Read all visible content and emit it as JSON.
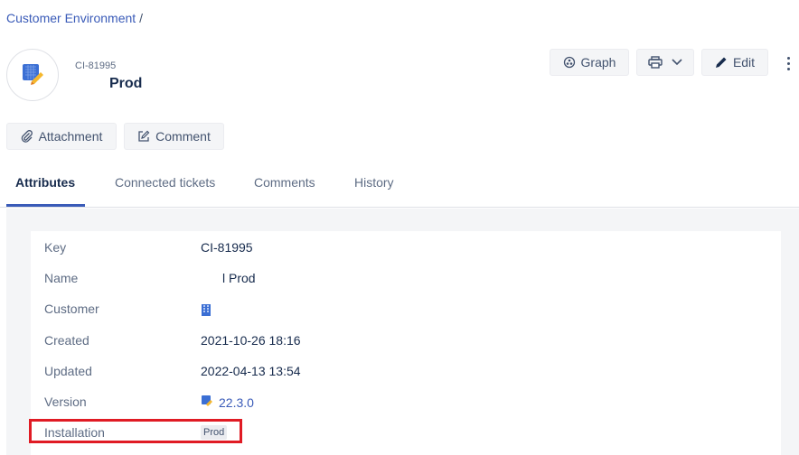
{
  "breadcrumb": {
    "parent": "Customer Environment",
    "separator": "/"
  },
  "header": {
    "key": "CI-81995",
    "title": "Prod"
  },
  "toolbar": {
    "graph_label": "Graph",
    "edit_label": "Edit"
  },
  "actions": {
    "attachment_label": "Attachment",
    "comment_label": "Comment"
  },
  "tabs": [
    {
      "label": "Attributes"
    },
    {
      "label": "Connected tickets"
    },
    {
      "label": "Comments"
    },
    {
      "label": "History"
    }
  ],
  "attributes": [
    {
      "label": "Key",
      "value": "CI-81995"
    },
    {
      "label": "Name",
      "value": "l Prod"
    },
    {
      "label": "Customer",
      "value": ""
    },
    {
      "label": "Created",
      "value": "2021-10-26 18:16"
    },
    {
      "label": "Updated",
      "value": "2022-04-13 13:54"
    },
    {
      "label": "Version",
      "value": "22.3.0"
    },
    {
      "label": "Installation",
      "value": "Prod"
    }
  ],
  "colors": {
    "accent": "#3a5bb8",
    "highlight": "#e01b24"
  }
}
